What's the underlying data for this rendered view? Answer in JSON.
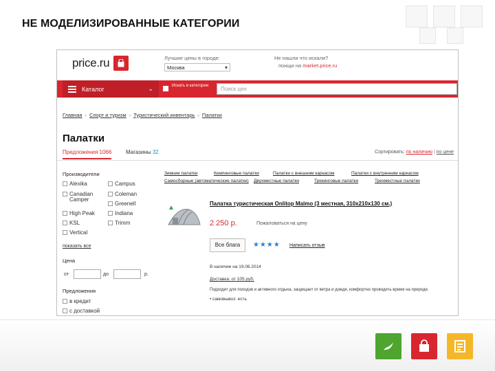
{
  "slide": {
    "title": "НЕ МОДЕЛИЗИРОВАННЫЕ КАТЕГОРИИ",
    "accent_colors": {
      "green": "#4ea52f",
      "red": "#d9262e",
      "yellow": "#f5b72a"
    }
  },
  "site": {
    "logo_text": "price.ru",
    "city_label": "Лучшие цены в городе:",
    "city_value": "Москва",
    "not_found_label": "Не нашли что искали?",
    "search_on_label": "поищи на",
    "search_on_link": "market.price.ru",
    "catalog_label": "Каталог",
    "nav_check_label": "Искать в категории",
    "search_placeholder": "Поиск цен"
  },
  "breadcrumb": [
    "Главная",
    "Спорт и туризм",
    "Туристический инвентарь",
    "Палатки"
  ],
  "page": {
    "heading": "Палатки",
    "tab_offers_label": "Предложения",
    "tab_offers_count": "1066",
    "tab_shops_label": "Магазины",
    "tab_shops_count": "32",
    "sort_label": "Сортировать:",
    "sort_active": "по наличию",
    "sort_other": "по цене"
  },
  "filters": {
    "manufacturers_heading": "Производители",
    "brands": [
      "Alexika",
      "Campus",
      "Canadian Camper",
      "Coleman",
      "Greenell",
      "High Peak",
      "Indiana",
      "KSL",
      "Trimm",
      "Vertical"
    ],
    "show_all": "показать все",
    "price_heading": "Цена",
    "price_from": "от",
    "price_to": "до",
    "currency": "р.",
    "offers_heading": "Предложения",
    "credit_label": "в кредит",
    "delivery_label": "с доставкой"
  },
  "categories": [
    "Зимние палатки",
    "Кемпинговые палатки",
    "Палатки с внешним каркасом",
    "Палатки с внутренним каркасом",
    "Самосборные (автоматические палатки)",
    "Двухместные палатки",
    "Трекинговые палатки",
    "Трехместные палатки"
  ],
  "product": {
    "title": "Палатка туристическая Onlitop Malmo (3 местная, 310x210x130 см.)",
    "price": "2 250 р.",
    "complain": "Пожаловаться на цену",
    "offers_button": "Все блага",
    "stars": "★★★★",
    "review_link": "Написать отзыв",
    "availability": "В наличии на 19.06.2014",
    "delivery": "Доставка: от 105 руб.",
    "description": "Подходит для походов и активного отдыха, защищает от ветра и дождя, комфортно проводить время на природе.",
    "bullet": "• самовывоз: есть"
  }
}
